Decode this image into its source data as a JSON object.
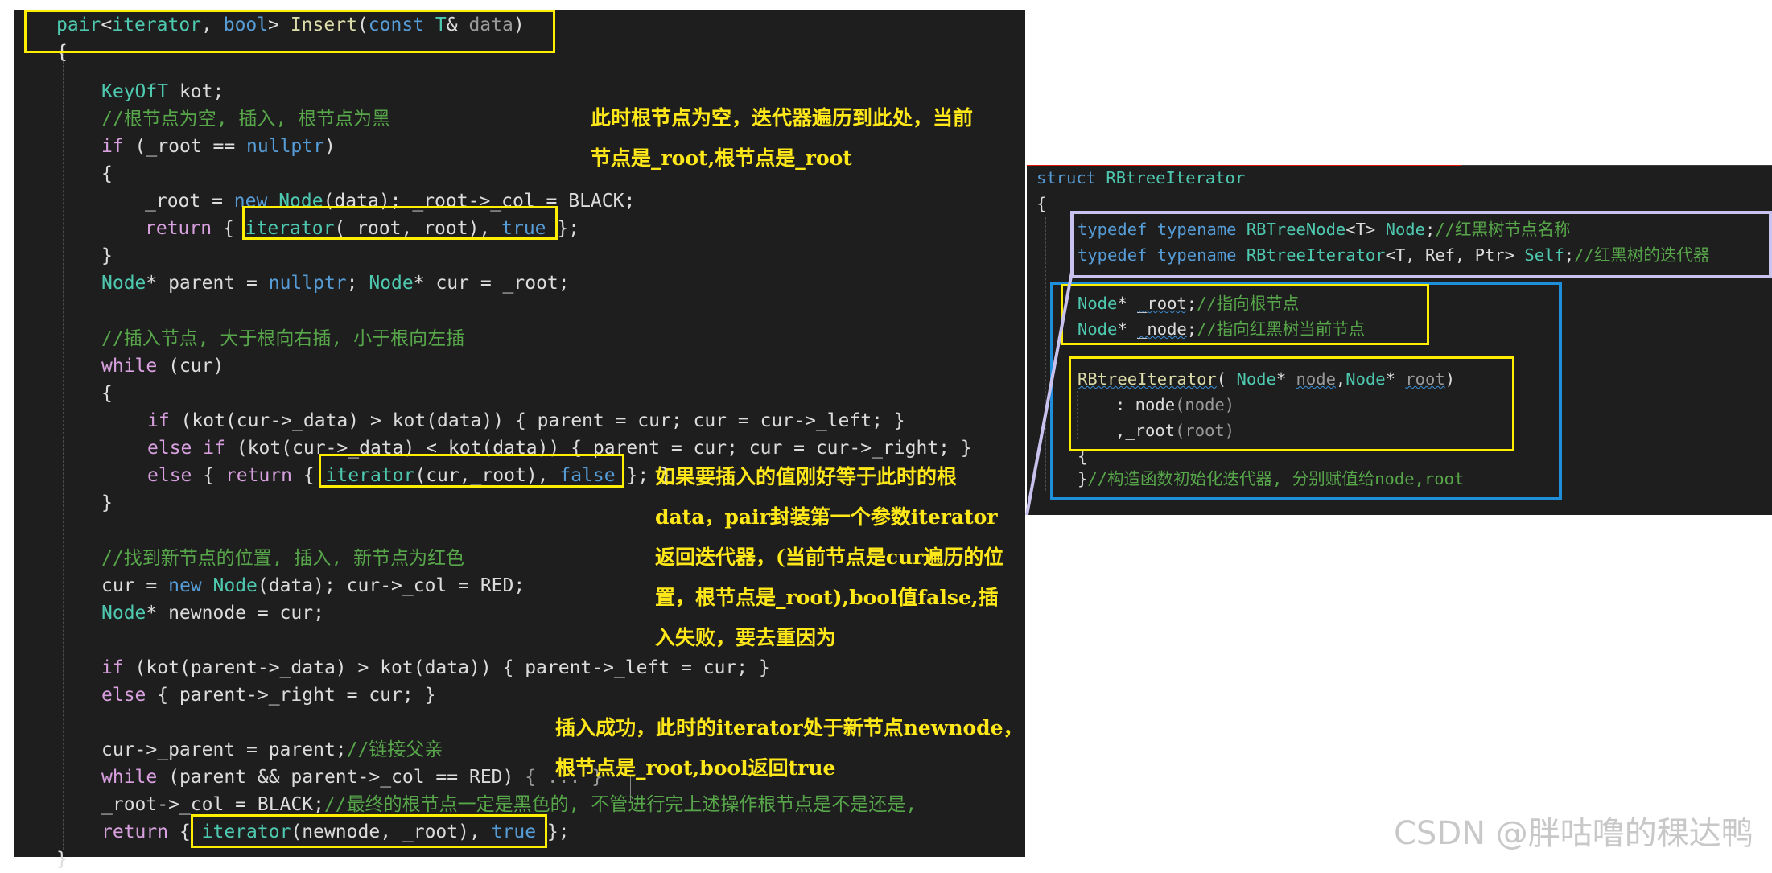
{
  "left_code": {
    "l01": {
      "a": "pair<iterator, bool> ",
      "b": "Insert",
      "c": "(",
      "d": "const",
      "e": " T& ",
      "f": "data",
      ")": ")"
    },
    "l02": "{",
    "l03a": "KeyOfT",
    "l03b": " kot;",
    "l04": "//根节点为空, 插入, 根节点为黑",
    "l05a": "if",
    "l05b": " (_root == ",
    "l05c": "nullptr",
    "l05d": ")",
    "l06": "{",
    "l07a": "_root = ",
    "l07b": "new",
    "l07c": "Node",
    "l07d": "(data); _root->_col = BLACK;",
    "l08a": "return",
    "l08b": " { ",
    "l08c": "iterator",
    "l08d": "(_root,_root), ",
    "l08e": "true",
    "l08f": " };",
    "l09": "}",
    "l10a": "Node",
    "l10b": "* parent = ",
    "l10c": "nullptr",
    "l10d": "; ",
    "l10e": "Node",
    "l10f": "* cur = _root;",
    "l11": "//插入节点, 大于根向右插, 小于根向左插",
    "l12a": "while",
    "l12b": " (cur)",
    "l13": "{",
    "l14a": "if",
    "l14b": " (kot(cur->_data) > kot(data)) { parent = cur; cur = cur->_left; }",
    "l15a": "else if",
    "l15b": " (kot(cur->_data) < kot(data)) { parent = cur; cur = cur->_right; }",
    "l16a": "else",
    "l16b": " { ",
    "l16c": "return",
    "l16d": " { ",
    "l16e": "iterator",
    "l16f": "(cur,_root), ",
    "l16g": "false",
    "l16h": " }; }",
    "l17": "}",
    "l18": "//找到新节点的位置, 插入, 新节点为红色",
    "l19a": "cur = ",
    "l19b": "new",
    "l19c": "Node",
    "l19d": "(data); cur->_col = RED;",
    "l20a": "Node",
    "l20b": "* newnode = cur;",
    "l21a": "if",
    "l21b": " (kot(parent->_data) > kot(data)) { parent->_left = cur; }",
    "l22a": "else",
    "l22b": " { parent->_right = cur; }",
    "l23a": "cur->_parent = parent;",
    "l23b": "//链接父亲",
    "l24a": "while",
    "l24b": " (parent && parent->_col == RED)",
    "l24c": " { ... }",
    "l25a": "_root->_col = BLACK;",
    "l25b": "//最终的根节点一定是黑色的, 不管进行完上述操作根节点是不是还是,",
    "l26a": "return",
    "l26b": " { ",
    "l26c": "iterator",
    "l26d": "(newnode, _root), ",
    "l26e": "true",
    "l26f": " };",
    "l27": "}"
  },
  "right_code": {
    "r01a": "struct",
    "r01b": " RBtreeIterator",
    "r02": "{",
    "r03a": "typedef",
    "r03b": " typename ",
    "r03c": "RBTreeNode",
    "r03d": "<T> ",
    "r03e": "Node",
    "r03f": ";",
    "r03g": "//红黑树节点名称",
    "r04a": "typedef",
    "r04b": " typename ",
    "r04c": "RBtreeIterator",
    "r04d": "<T, Ref, Ptr> ",
    "r04e": "Self",
    "r04f": ";",
    "r04g": "//红黑树的迭代器",
    "r05a": "Node",
    "r05b": "* ",
    "r05c": "_root",
    "r05d": ";",
    "r05e": "//指向根节点",
    "r06a": "Node",
    "r06b": "* ",
    "r06c": "_node",
    "r06d": ";",
    "r06e": "//指向红黑树当前节点",
    "r07a": "RBtreeIterator",
    "r07b": "( ",
    "r07c": "Node",
    "r07d": "* ",
    "r07e": "node",
    "r07f": ",",
    "r07g": "Node",
    "r07h": "* ",
    "r07i": "root",
    "r07j": ")",
    "r08a": ":",
    "r08b": "_node",
    "r08c": "(node)",
    "r09a": ",",
    "r09b": "_root",
    "r09c": "(root)",
    "r10": "{",
    "r11a": "}",
    "r11b": "//构造函数初始化迭代器, 分别赋值给node,root"
  },
  "notes": {
    "note1": "此时根节点为空，迭代器遍历到此处，当前\n节点是_root,根节点是_root",
    "note2": "如果要插入的值刚好等于此时的根\ndata，pair封装第一个参数iterator\n返回迭代器，(当前节点是cur遍历的位\n置，根节点是_root),bool值false,插\n入失败，要去重因为",
    "note3": "插入成功，此时的iterator处于新节点newnode，\n根节点是_root,bool返回true"
  },
  "watermark": "CSDN @胖咕噜的稞达鸭",
  "colors": {
    "editor_bg": "#1e1e1e",
    "annotation_yellow": "#ffee00",
    "annotation_blue": "#1f8fdc",
    "annotation_lavender": "#c8c2ee",
    "keyword": "#569cd6",
    "type": "#4ec9b0",
    "comment": "#57a64a",
    "function": "#dcdcaa",
    "control": "#d8a0df"
  }
}
